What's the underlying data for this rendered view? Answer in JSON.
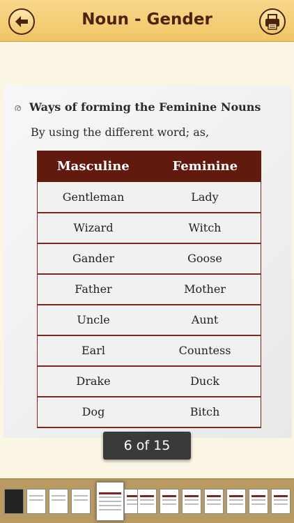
{
  "header": {
    "title": "Noun - Gender",
    "back_icon": "back-arrow-icon",
    "print_icon": "printer-icon"
  },
  "content": {
    "heading": "Ways of forming the Feminine Nouns",
    "heading_icon_glyph": "ര",
    "description": "By using the different word; as,",
    "table": {
      "headers": [
        "Masculine",
        "Feminine"
      ],
      "rows": [
        [
          "Gentleman",
          "Lady"
        ],
        [
          "Wizard",
          "Witch"
        ],
        [
          "Gander",
          "Goose"
        ],
        [
          "Father",
          "Mother"
        ],
        [
          "Uncle",
          "Aunt"
        ],
        [
          "Earl",
          "Countess"
        ],
        [
          "Drake",
          "Duck"
        ],
        [
          "Dog",
          "Bitch"
        ]
      ]
    }
  },
  "pager": {
    "label": "6 of 15",
    "current": 6,
    "total": 15
  },
  "colors": {
    "header_bg": "#f2c868",
    "header_text": "#4b2410",
    "table_header_bg": "#621a0e",
    "page_bg": "#fbf5e3",
    "thumbstrip_bg": "#b99a62"
  }
}
